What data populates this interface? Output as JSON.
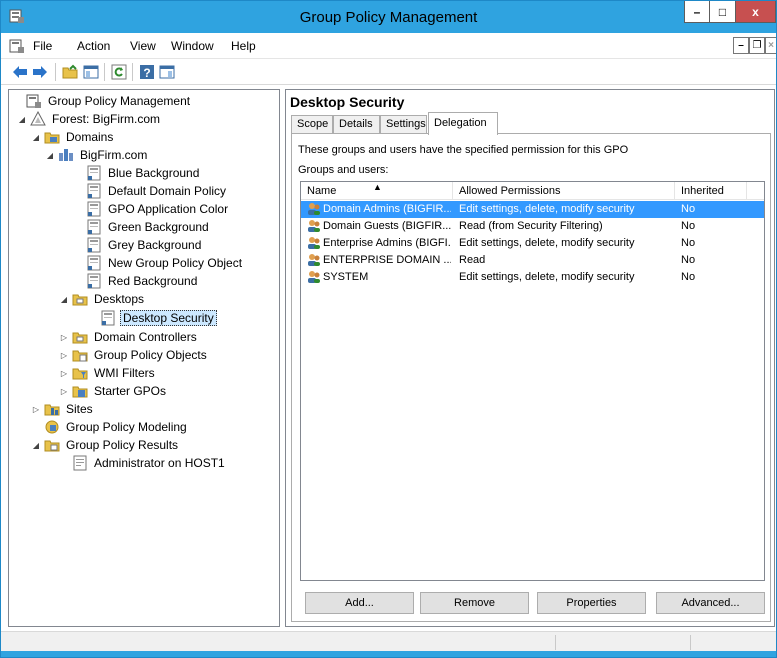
{
  "window": {
    "title": "Group Policy Management",
    "min_glyph": "–",
    "max_glyph": "□",
    "close_glyph": "x"
  },
  "menu": {
    "items": [
      "File",
      "Action",
      "View",
      "Window",
      "Help"
    ],
    "mdi_min": "–",
    "mdi_restore": "❐",
    "mdi_close": "×"
  },
  "toolbar": {
    "icons": [
      "back-arrow-icon",
      "forward-arrow-icon",
      "folder-up-icon",
      "show-hide-tree-icon",
      "refresh-icon",
      "help-icon",
      "console-view-icon"
    ]
  },
  "tree": {
    "items": [
      {
        "label": "Group Policy Management",
        "icon": "gpm-root-icon",
        "expander": ""
      },
      {
        "label": "Forest: BigFirm.com",
        "icon": "forest-icon",
        "expander": "◢"
      },
      {
        "label": "Domains",
        "icon": "domains-icon",
        "expander": "◢"
      },
      {
        "label": "BigFirm.com",
        "icon": "domain-icon",
        "expander": "◢"
      },
      {
        "label": "Blue Background",
        "icon": "gpo-link-icon",
        "expander": ""
      },
      {
        "label": "Default Domain Policy",
        "icon": "gpo-link-icon",
        "expander": ""
      },
      {
        "label": "GPO Application Color",
        "icon": "gpo-link-icon",
        "expander": ""
      },
      {
        "label": "Green Background",
        "icon": "gpo-link-icon",
        "expander": ""
      },
      {
        "label": "Grey Background",
        "icon": "gpo-link-icon",
        "expander": ""
      },
      {
        "label": "New Group Policy Object",
        "icon": "gpo-link-icon",
        "expander": ""
      },
      {
        "label": "Red Background",
        "icon": "gpo-link-icon",
        "expander": ""
      },
      {
        "label": "Desktops",
        "icon": "ou-folder-icon",
        "expander": "◢"
      },
      {
        "label": "Desktop Security",
        "icon": "gpo-link-icon",
        "expander": ""
      },
      {
        "label": "Domain Controllers",
        "icon": "ou-folder-icon",
        "expander": "▷"
      },
      {
        "label": "Group Policy Objects",
        "icon": "gpo-container-icon",
        "expander": "▷"
      },
      {
        "label": "WMI Filters",
        "icon": "wmi-filters-icon",
        "expander": "▷"
      },
      {
        "label": "Starter GPOs",
        "icon": "starter-gpos-icon",
        "expander": "▷"
      },
      {
        "label": "Sites",
        "icon": "sites-icon",
        "expander": "▷"
      },
      {
        "label": "Group Policy Modeling",
        "icon": "modeling-icon",
        "expander": ""
      },
      {
        "label": "Group Policy Results",
        "icon": "results-icon",
        "expander": "◢"
      },
      {
        "label": "Administrator on HOST1",
        "icon": "result-report-icon",
        "expander": ""
      }
    ]
  },
  "details": {
    "title": "Desktop Security",
    "tabs": [
      "Scope",
      "Details",
      "Settings",
      "Delegation"
    ],
    "active_tab": "Delegation",
    "description": "These groups and users have the specified permission for this GPO",
    "groups_label": "Groups and users:",
    "columns": [
      "Name",
      "Allowed Permissions",
      "Inherited"
    ],
    "sort_glyph": "▲",
    "rows": [
      {
        "name": "Domain Admins (BIGFIR...",
        "permission": "Edit settings, delete, modify security",
        "inherited": "No"
      },
      {
        "name": "Domain Guests (BIGFIR...",
        "permission": "Read (from Security Filtering)",
        "inherited": "No"
      },
      {
        "name": "Enterprise Admins (BIGFI...",
        "permission": "Edit settings, delete, modify security",
        "inherited": "No"
      },
      {
        "name": "ENTERPRISE DOMAIN ...",
        "permission": "Read",
        "inherited": "No"
      },
      {
        "name": "SYSTEM",
        "permission": "Edit settings, delete, modify security",
        "inherited": "No"
      }
    ],
    "buttons": {
      "add": "Add...",
      "remove": "Remove",
      "properties": "Properties",
      "advanced": "Advanced..."
    }
  },
  "colors": {
    "titlebar": "#2fa3e0",
    "close_button": "#c75050",
    "selection": "#3399ff"
  }
}
